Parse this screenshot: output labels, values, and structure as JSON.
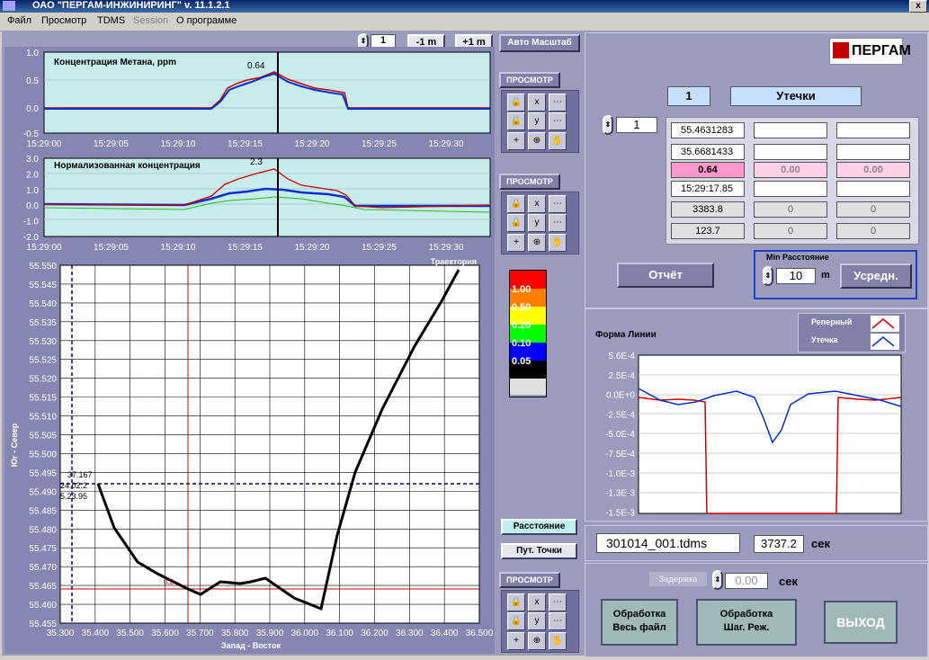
{
  "window": {
    "title": "ОАО \"ПЕРГАМ-ИНЖИНИРИНГ\"    v. 11.1.2.1",
    "close": "x"
  },
  "menu": [
    "Файл",
    "Просмотр",
    "TDMS",
    "Session",
    "О программе"
  ],
  "top_controls": {
    "counter": "1",
    "minus_label": "-1 m",
    "plus_label": "+1 m",
    "auto_scale": "Авто Масштаб"
  },
  "view_label": "ПРОСМОТР",
  "chart1": {
    "title": "Концентрация Метана, ppm",
    "cursor_value": "0.64",
    "y_ticks": [
      "1.0",
      "0.5",
      "0.0",
      "-0.5"
    ],
    "x_ticks": [
      "15:29:00",
      "15:29:05",
      "15:29:10",
      "15:29:15",
      "15:29:20",
      "15:29:25",
      "15:29:30",
      "15:29:"
    ]
  },
  "chart2": {
    "title": "Нормализованная концентрация",
    "cursor_value": "2.3",
    "y_ticks": [
      "3.0",
      "2.0",
      "1.0",
      "0.0",
      "-1.0",
      "-2.0"
    ],
    "x_ticks": [
      "15:29:00",
      "15:29:05",
      "15:29:10",
      "15:29:15",
      "15:29:20",
      "15:29:25",
      "15:29:30",
      "15:29:"
    ]
  },
  "trajectory": {
    "title": "Траектория",
    "ylabel": "Юг - Север",
    "xlabel": "Запад - Восток",
    "y_ticks": [
      "55.550",
      "55.545",
      "55.540",
      "55.535",
      "55.530",
      "55.525",
      "55.520",
      "55.515",
      "55.510",
      "55.505",
      "55.500",
      "55.495",
      "55.490",
      "55.485",
      "55.480",
      "55.475",
      "55.470",
      "55.465",
      "55.460",
      "55.455"
    ],
    "x_ticks": [
      "35.300",
      "35.400",
      "35.500",
      "35.600",
      "35.700",
      "35.800",
      "35.900",
      "36.000",
      "36.100",
      "36.200",
      "36.300",
      "36.400",
      "36.500"
    ],
    "cursor_labels": [
      "37.167",
      "24.02.2",
      "5.23.95"
    ],
    "marker_label": "0.2"
  },
  "color_scale": [
    "1.00",
    "0.50",
    "0.20",
    "0.10",
    "0.05"
  ],
  "distance_btn": "Расстояние",
  "path_points_btn": "Пут. Точки",
  "logo": "ПЕРГАМ",
  "leak": {
    "index": "1",
    "label": "Утечки",
    "selector": "1"
  },
  "table": {
    "col1": [
      "55.4631283",
      "35.6681433",
      "0.64",
      "15:29:17.85",
      "3383.8",
      "123.7"
    ],
    "col2": [
      "",
      "",
      "0.00",
      "",
      "0",
      "0"
    ],
    "col3": [
      "",
      "",
      "0.00",
      "",
      "0",
      "0"
    ]
  },
  "report_btn": "Отчёт",
  "min_distance": {
    "label": "Min Расстояние",
    "value": "10",
    "unit": "m",
    "avg_btn": "Усредн."
  },
  "line_shape": {
    "title": "Форма Линии",
    "legend": [
      {
        "name": "Реперный",
        "color": "#d00000"
      },
      {
        "name": "Утечка",
        "color": "#0030d0"
      }
    ],
    "y_ticks": [
      "5.6E-4",
      "2.5E-4",
      "0.0E+0",
      "-2.5E-4",
      "-5.0E-4",
      "-7.5E-4",
      "-1.0E-3",
      "-1.3E-3",
      "-1.5E-3"
    ]
  },
  "file": {
    "name": "301014_001.tdms",
    "seconds": "3737.2",
    "unit": "сек"
  },
  "delay": {
    "label": "Задержка",
    "value": "0.00",
    "unit": "сек"
  },
  "buttons": {
    "process_all": [
      "Обработка",
      "Весь файл"
    ],
    "process_step": [
      "Обработка",
      "Шаг. Реж."
    ],
    "exit": "ВЫХОД"
  }
}
